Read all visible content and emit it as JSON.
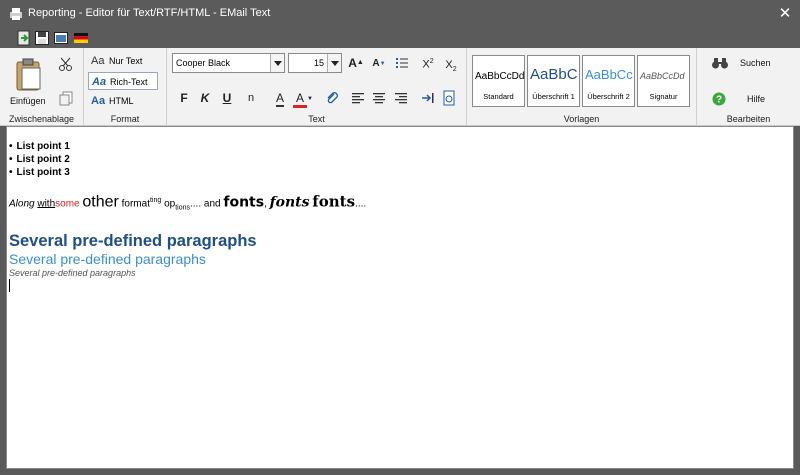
{
  "window": {
    "title": "Reporting - Editor für Text/RTF/HTML - EMail Text",
    "close_label": "✕"
  },
  "ribbon": {
    "clipboard": {
      "group_label": "Zwischenablage",
      "paste_label": "Einfügen"
    },
    "format": {
      "group_label": "Format",
      "plain_text": "Nur Text",
      "rich_text": "Rich-Text",
      "html": "HTML",
      "icon_glyph": "Aa"
    },
    "text": {
      "group_label": "Text",
      "font_name": "Cooper Black",
      "font_size": "15",
      "bold": "F",
      "italic": "K",
      "underline": "U",
      "normal": "n",
      "highlight": "A",
      "font_color": "A",
      "grow": "A",
      "shrink": "A",
      "superscript": "X",
      "superscript_mark": "2",
      "subscript": "X",
      "subscript_mark": "2"
    },
    "styles": {
      "group_label": "Vorlagen",
      "items": [
        {
          "preview": "AaBbCcDd",
          "name": "Standard"
        },
        {
          "preview": "AaBbC",
          "name": "Überschrift 1"
        },
        {
          "preview": "AaBbCc",
          "name": "Überschrift 2"
        },
        {
          "preview": "AaBbCcDd",
          "name": "Signatur"
        }
      ]
    },
    "edit": {
      "group_label": "Bearbeiten",
      "search_label": "Suchen",
      "help_label": "Hilfe"
    }
  },
  "document": {
    "list": [
      "List point 1",
      "List point 2",
      "List point 3"
    ],
    "mixed": {
      "along": "Along",
      "with": "with",
      "some": "some",
      "other": "other",
      "format": "format",
      "ting": "ting",
      "op": "op",
      "tions": "tions",
      "dots1": "....",
      "and": "and",
      "fonts1": "fonts",
      "comma": ",",
      "fonts2": "fonts",
      "fonts3": "fonts",
      "dots2": "...."
    },
    "heading1": "Several pre-defined paragraphs",
    "heading2": "Several pre-defined paragraphs",
    "signature": "Several pre-defined paragraphs"
  },
  "colors": {
    "titlebar": "#5b5b5b",
    "heading1": "#1f4e8c",
    "heading2": "#3a8fd6",
    "red_text": "#e02020",
    "font_color_bar": "#e02020"
  }
}
